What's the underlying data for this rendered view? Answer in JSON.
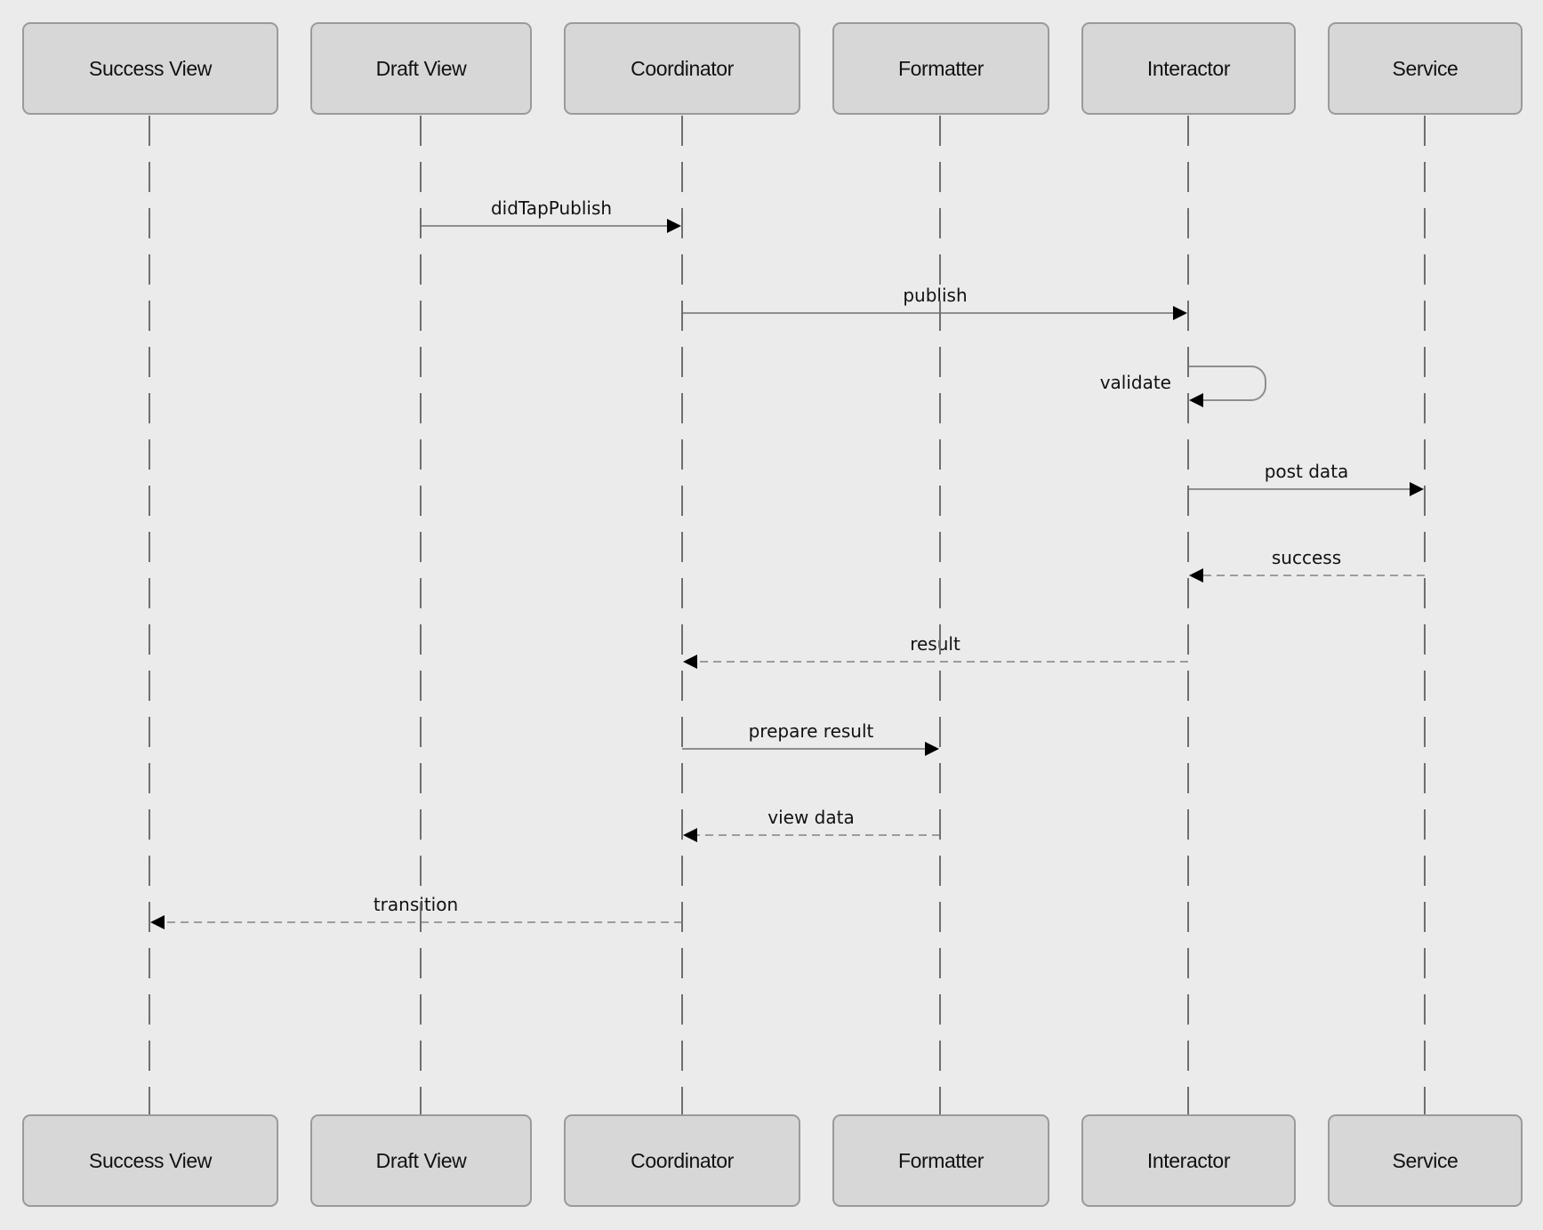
{
  "diagram": {
    "type": "sequence-diagram",
    "colors": {
      "background": "#ebebeb",
      "participant_fill": "#d7d7d7",
      "participant_border": "#9a9a9a",
      "lifeline": "#6f6f6f",
      "message_line": "#8e8e8e",
      "arrowhead": "#000000"
    },
    "participants": [
      {
        "id": "success_view",
        "label": "Success View"
      },
      {
        "id": "draft_view",
        "label": "Draft View"
      },
      {
        "id": "coordinator",
        "label": "Coordinator"
      },
      {
        "id": "formatter",
        "label": "Formatter"
      },
      {
        "id": "interactor",
        "label": "Interactor"
      },
      {
        "id": "service",
        "label": "Service"
      }
    ],
    "messages": [
      {
        "from": "draft_view",
        "to": "coordinator",
        "label": "didTapPublish",
        "kind": "call"
      },
      {
        "from": "coordinator",
        "to": "interactor",
        "label": "publish",
        "kind": "call"
      },
      {
        "from": "interactor",
        "to": "interactor",
        "label": "validate",
        "kind": "self"
      },
      {
        "from": "interactor",
        "to": "service",
        "label": "post data",
        "kind": "call"
      },
      {
        "from": "service",
        "to": "interactor",
        "label": "success",
        "kind": "reply"
      },
      {
        "from": "interactor",
        "to": "coordinator",
        "label": "result",
        "kind": "reply"
      },
      {
        "from": "coordinator",
        "to": "formatter",
        "label": "prepare result",
        "kind": "call"
      },
      {
        "from": "formatter",
        "to": "coordinator",
        "label": "view data",
        "kind": "reply"
      },
      {
        "from": "coordinator",
        "to": "success_view",
        "label": "transition",
        "kind": "reply"
      }
    ]
  }
}
